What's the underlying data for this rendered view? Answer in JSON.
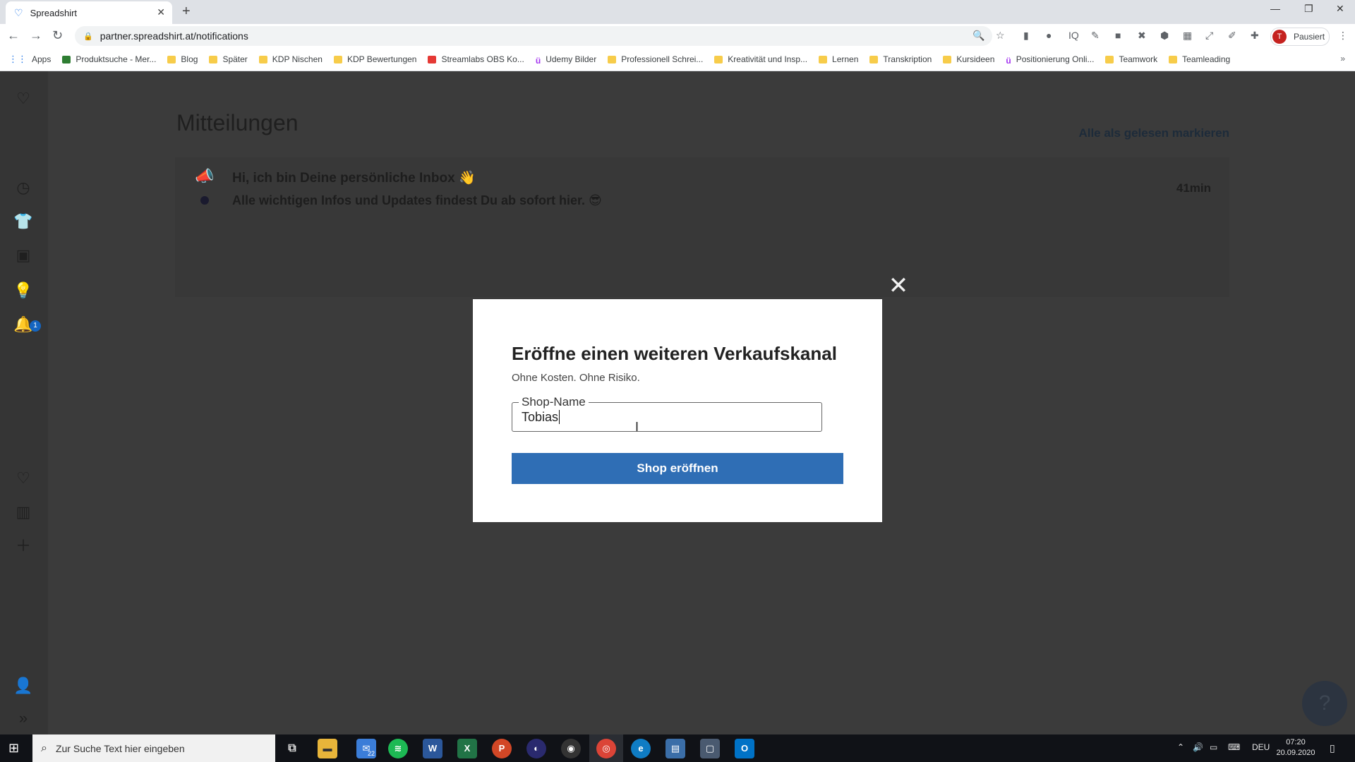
{
  "browser": {
    "tab_title": "Spreadshirt",
    "url": "partner.spreadshirt.at/notifications",
    "profile_status": "Pausiert",
    "profile_initial": "T",
    "bookmarks": [
      {
        "label": "Apps",
        "icon": "apps-grid-icon"
      },
      {
        "label": "Produktsuche - Mer...",
        "icon": "bookmark-green-icon"
      },
      {
        "label": "Blog",
        "icon": "folder-icon"
      },
      {
        "label": "Später",
        "icon": "folder-icon"
      },
      {
        "label": "KDP Nischen",
        "icon": "folder-icon"
      },
      {
        "label": "KDP Bewertungen",
        "icon": "folder-icon"
      },
      {
        "label": "Streamlabs OBS Ko...",
        "icon": "youtube-icon"
      },
      {
        "label": "Udemy Bilder",
        "icon": "udemy-icon"
      },
      {
        "label": "Professionell Schrei...",
        "icon": "folder-icon"
      },
      {
        "label": "Kreativität und Insp...",
        "icon": "folder-icon"
      },
      {
        "label": "Lernen",
        "icon": "folder-icon"
      },
      {
        "label": "Transkription",
        "icon": "folder-icon"
      },
      {
        "label": "Kursideen",
        "icon": "folder-icon"
      },
      {
        "label": "Positionierung Onli...",
        "icon": "udemy-icon"
      },
      {
        "label": "Teamwork",
        "icon": "folder-icon"
      },
      {
        "label": "Teamleading",
        "icon": "folder-icon"
      }
    ]
  },
  "page": {
    "title": "Mitteilungen",
    "mark_all_read": "Alle als gelesen markieren",
    "sidebar_badge": "1",
    "notification": {
      "title": "Hi, ich bin Deine persönliche Inbox 👋",
      "text": "Alle wichtigen Infos und Updates findest Du ab sofort hier. 😎",
      "time": "41min"
    },
    "help_label": "?"
  },
  "modal": {
    "title": "Eröffne einen weiteren Verkaufskanal",
    "subtitle": "Ohne Kosten. Ohne Risiko.",
    "field_label": "Shop-Name",
    "field_value": "Tobias",
    "button_label": "Shop eröffnen",
    "close_symbol": "✕"
  },
  "taskbar": {
    "search_placeholder": "Zur Suche Text hier eingeben",
    "mail_badge": "22",
    "language": "DEU",
    "time": "07:20",
    "date": "20.09.2020"
  },
  "colors": {
    "primary_button": "#2f6eb5",
    "overlay_background": "#3b3b3b"
  }
}
